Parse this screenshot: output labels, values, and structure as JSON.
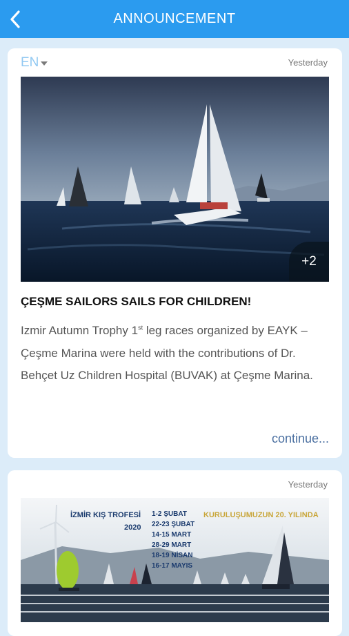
{
  "appbar": {
    "title": "ANNOUNCEMENT"
  },
  "post1": {
    "lang": "EN",
    "date": "Yesterday",
    "more_photos": "+2",
    "title": "ÇEŞME SAILORS SAILS FOR CHILDREN!",
    "body_part1": "Izmir Autumn Trophy 1",
    "body_sup": "st",
    "body_part2": " leg races organized by EAYK – Çeşme Marina were held with the contributions of Dr. Behçet Uz Children Hospital (BUVAK) at Çeşme Marina.",
    "continue": "continue..."
  },
  "post2": {
    "date": "Yesterday",
    "poster": {
      "heading": "İZMİR KIŞ TROFESİ",
      "year": "2020",
      "dates": [
        "1-2 ŞUBAT",
        "22-23 ŞUBAT",
        "14-15 MART",
        "28-29 MART",
        "18-19 NİSAN",
        "16-17 MAYIS"
      ],
      "anniversary": "KURULUŞUMUZUN 20. YILINDA"
    }
  },
  "colors": {
    "appbar": "#2b9bef",
    "background": "#dcecf9",
    "lang": "#92c9f2",
    "continue": "#4a6fa0"
  }
}
